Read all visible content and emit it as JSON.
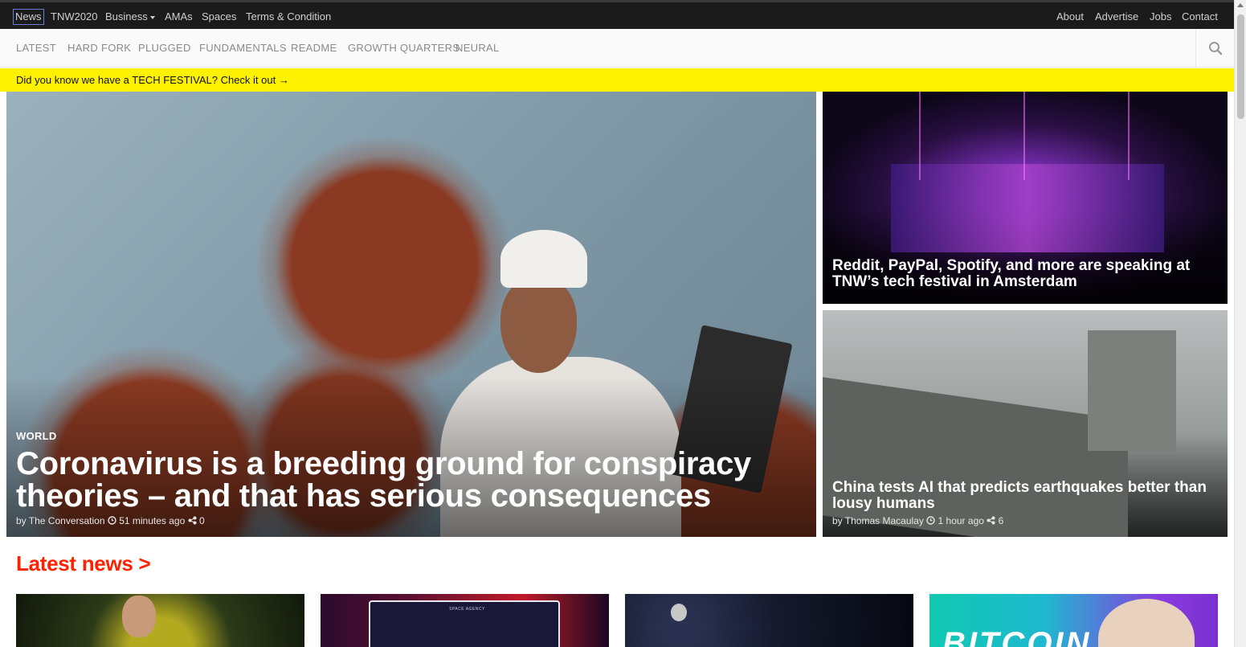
{
  "topbar": {
    "left": [
      "News",
      "TNW2020",
      "Business",
      "AMAs",
      "Spaces",
      "Terms & Condition"
    ],
    "right": [
      "About",
      "Advertise",
      "Jobs",
      "Contact"
    ]
  },
  "sections": [
    "LATEST",
    "HARD FORK",
    "PLUGGED",
    "FUNDAMENTALS",
    "README",
    "GROWTH QUARTERS",
    "NEURAL"
  ],
  "banner": "Did you know we have a TECH FESTIVAL? Check it out →",
  "hero": {
    "category": "WORLD",
    "title": "Coronavirus is a breeding ground for conspiracy theories – and that has serious consequences",
    "author": "by The Conversation",
    "time": "51 minutes ago",
    "shares": "0"
  },
  "side_stories": [
    {
      "title": "Reddit, PayPal, Spotify, and more are speaking at TNW’s tech festival in Amsterdam"
    },
    {
      "title": "China tests AI that predicts earthquakes better than lousy humans",
      "author": "by Thomas Macaulay",
      "time": "1 hour ago",
      "shares": "6"
    }
  ],
  "latest": {
    "title": "Latest news >",
    "thumb_texts": {
      "space_agency": "SPACE AGENCY",
      "bitcoin": "BITCOIN"
    }
  },
  "colors": {
    "accent": "#ff2200",
    "banner": "#fff200",
    "topbar": "#1b1b1b"
  },
  "icons": [
    "search-icon",
    "clock-icon",
    "share-icon",
    "caret-down-icon"
  ]
}
